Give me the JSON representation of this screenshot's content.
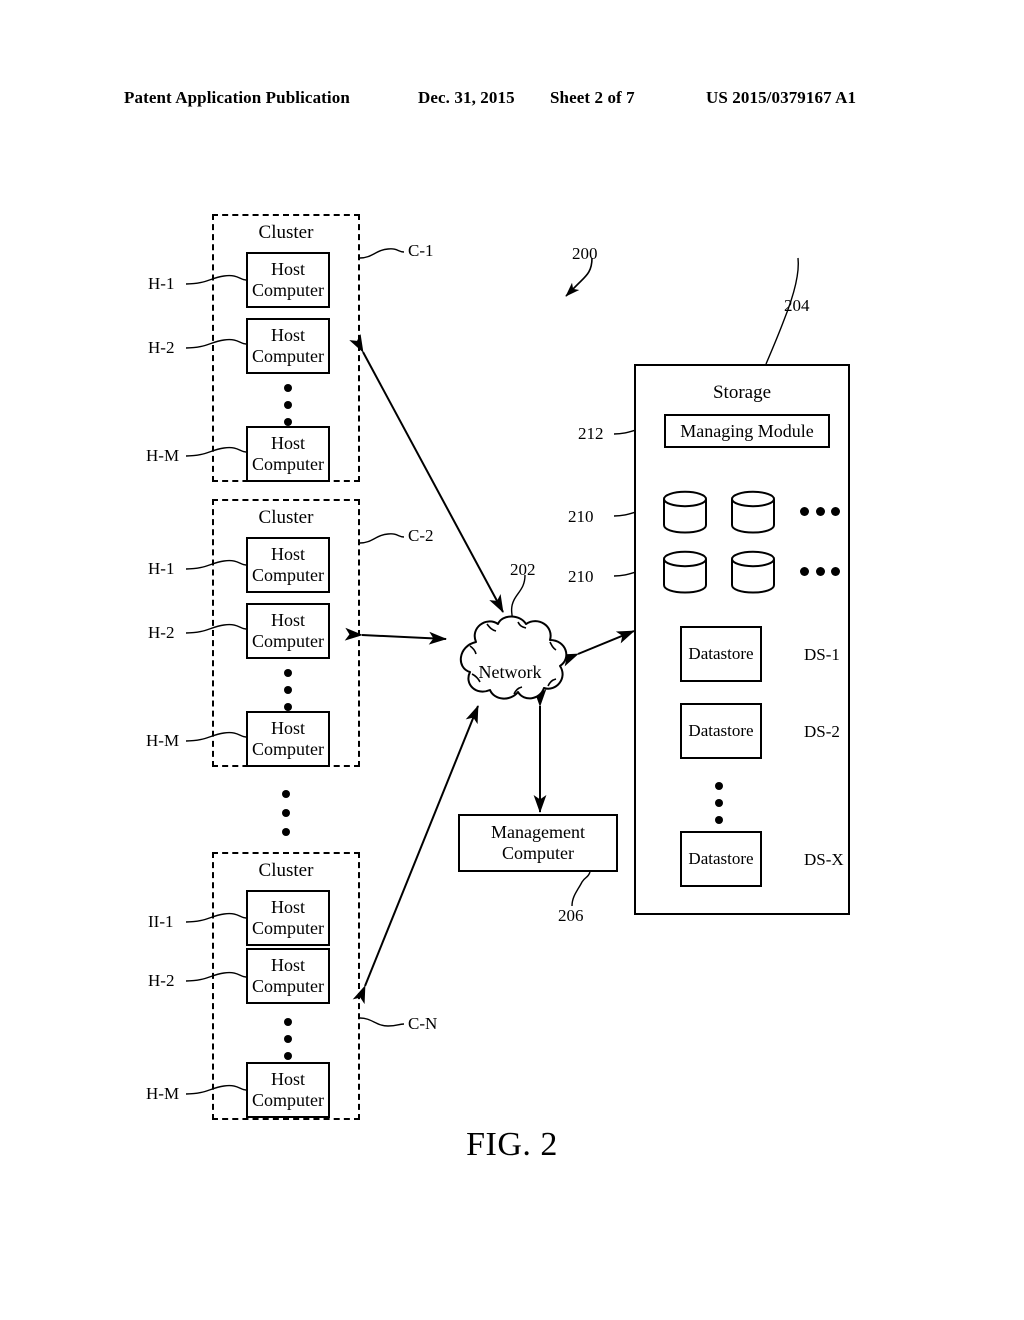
{
  "header": {
    "publication": "Patent Application Publication",
    "date": "Dec. 31, 2015",
    "sheet": "Sheet 2 of 7",
    "patent_number": "US 2015/0379167 A1"
  },
  "figure": {
    "caption": "FIG. 2",
    "system_ref": "200"
  },
  "clusters": [
    {
      "title": "Cluster",
      "ref": "C-1",
      "hosts": [
        {
          "line1": "Host",
          "line2": "Computer",
          "ref": "H-1"
        },
        {
          "line1": "Host",
          "line2": "Computer",
          "ref": "H-2"
        },
        {
          "line1": "Host",
          "line2": "Computer",
          "ref": "H-M"
        }
      ]
    },
    {
      "title": "Cluster",
      "ref": "C-2",
      "hosts": [
        {
          "line1": "Host",
          "line2": "Computer",
          "ref": "H-1"
        },
        {
          "line1": "Host",
          "line2": "Computer",
          "ref": "H-2"
        },
        {
          "line1": "Host",
          "line2": "Computer",
          "ref": "H-M"
        }
      ]
    },
    {
      "title": "Cluster",
      "ref": "C-N",
      "hosts": [
        {
          "line1": "Host",
          "line2": "Computer",
          "ref": "II-1"
        },
        {
          "line1": "Host",
          "line2": "Computer",
          "ref": "H-2"
        },
        {
          "line1": "Host",
          "line2": "Computer",
          "ref": "H-M"
        }
      ]
    }
  ],
  "network": {
    "label": "Network",
    "ref": "202"
  },
  "management_computer": {
    "line1": "Management",
    "line2": "Computer",
    "ref": "206"
  },
  "storage": {
    "title": "Storage",
    "ref": "204",
    "managing_module": {
      "label": "Managing Module",
      "ref": "212"
    },
    "disk_rows": [
      {
        "ref": "210"
      },
      {
        "ref": "210"
      }
    ],
    "datastores": [
      {
        "label": "Datastore",
        "ref": "DS-1"
      },
      {
        "label": "Datastore",
        "ref": "DS-2"
      },
      {
        "label": "Datastore",
        "ref": "DS-X"
      }
    ]
  },
  "colors": {
    "ink": "#000000",
    "paper": "#ffffff"
  }
}
